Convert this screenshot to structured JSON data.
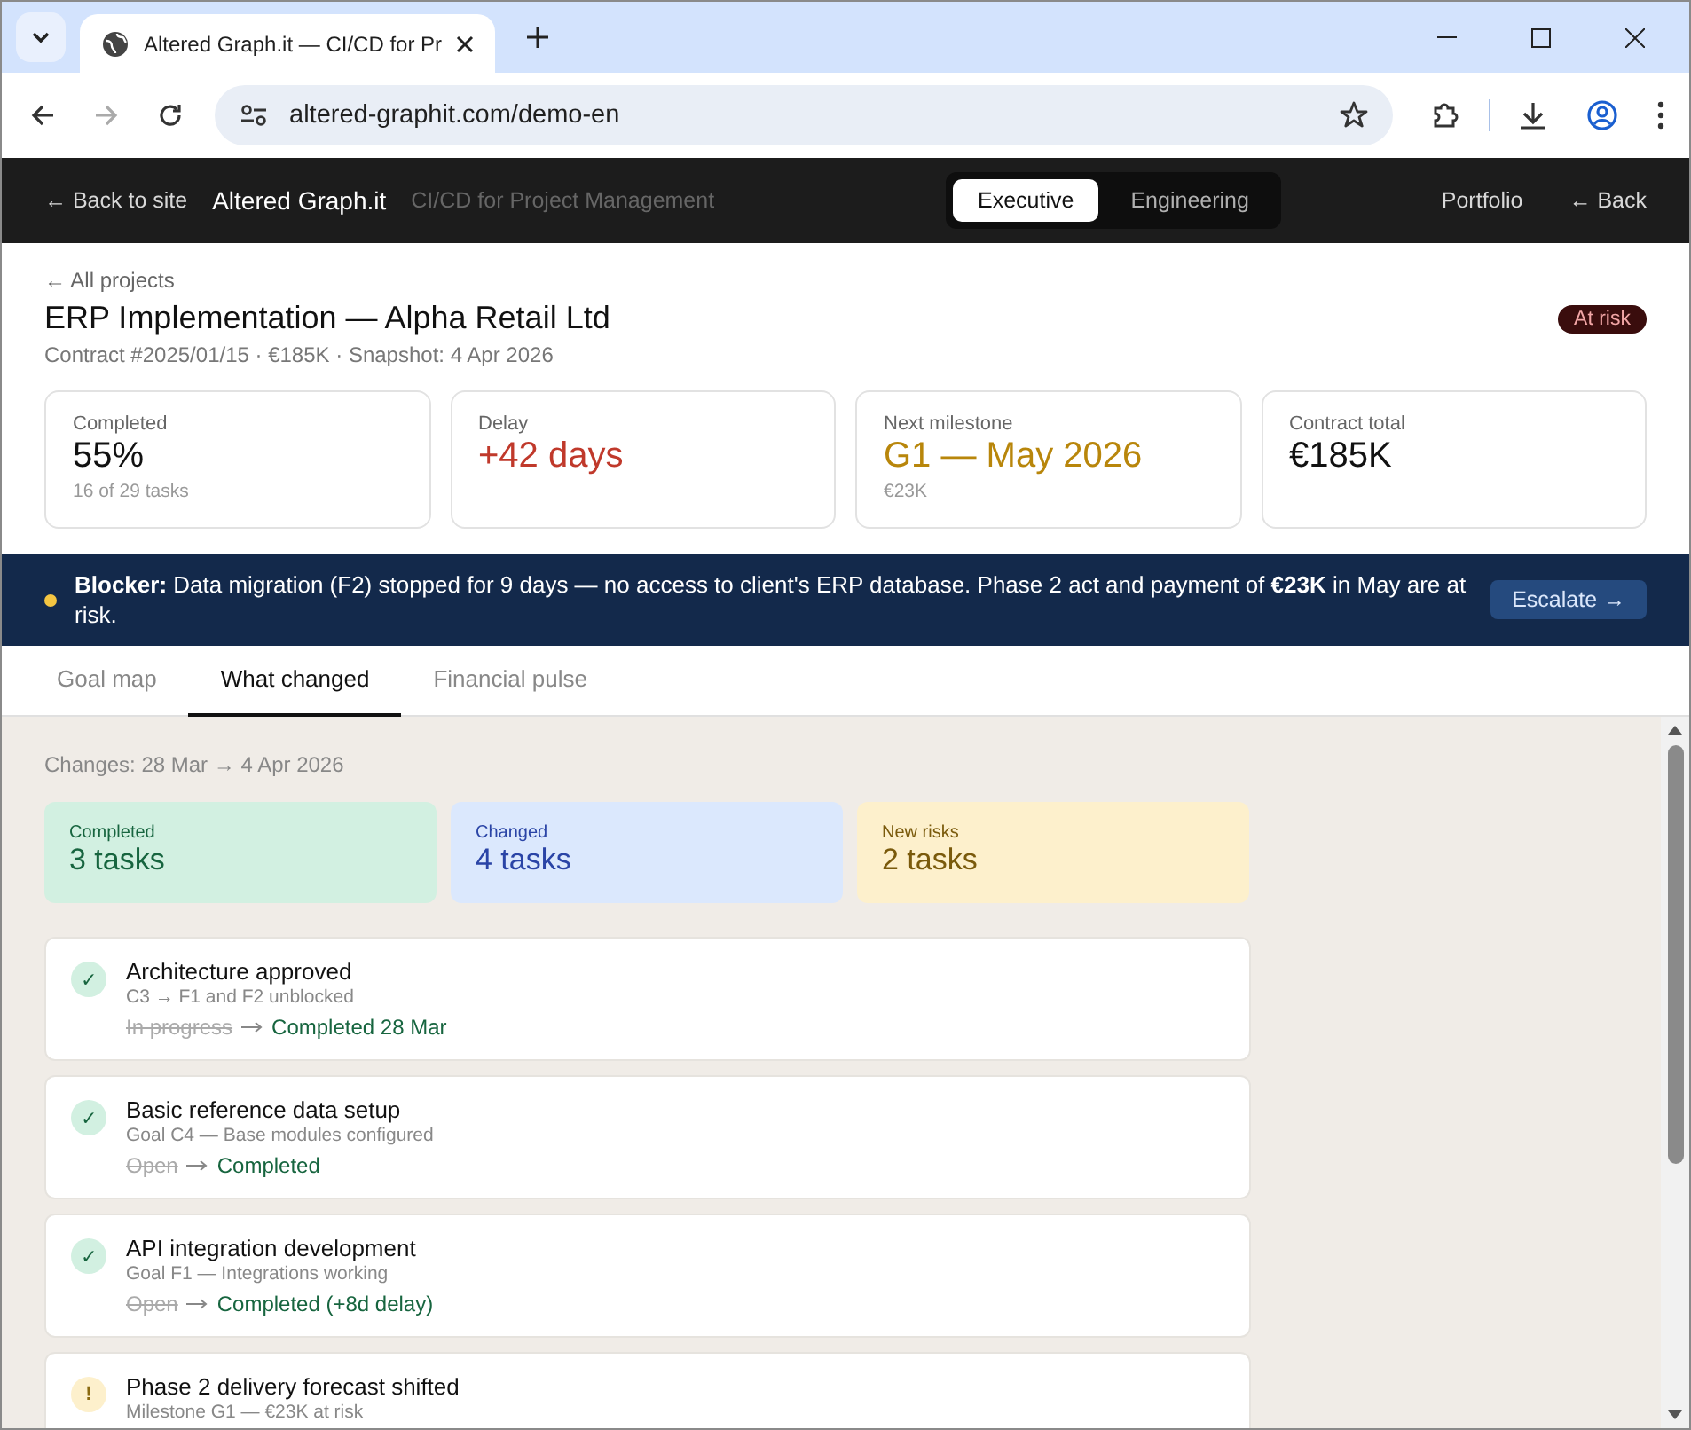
{
  "browser": {
    "tab_title": "Altered Graph.it — CI/CD for Pr",
    "url": "altered-graphit.com/demo-en"
  },
  "header": {
    "back_link": "← Back to site",
    "brand": "Altered Graph.it",
    "tagline": "CI/CD for Project Management",
    "views": [
      {
        "label": "Executive",
        "selected": true
      },
      {
        "label": "Engineering",
        "selected": false
      }
    ],
    "nav": [
      "Portfolio",
      "← Back"
    ]
  },
  "project": {
    "back_link": "← All projects",
    "title": "ERP Implementation — Alpha Retail Ltd",
    "meta": "Contract #2025/01/15 · €185K · Snapshot: 4 Apr 2026",
    "status": "At risk"
  },
  "kpis": [
    {
      "label": "Completed",
      "value": "55%",
      "note": "16 of 29 tasks"
    },
    {
      "label": "Delay",
      "value": "+42 days",
      "color": "#c0392b"
    },
    {
      "label": "Next milestone",
      "value": "G1 — May 2026",
      "note": "€23K",
      "color": "#b8860b"
    },
    {
      "label": "Contract total",
      "value": "€185K"
    }
  ],
  "blocker": {
    "text": "**Blocker:** Data migration (F2) stopped for 9 days — no access to client's ERP database. Phase 2 act and payment of **€23K** in May are at risk.",
    "action": "Escalate →"
  },
  "tabs": [
    {
      "label": "Goal map",
      "selected": false
    },
    {
      "label": "What changed",
      "selected": true
    },
    {
      "label": "Financial pulse",
      "selected": false
    }
  ],
  "changes": {
    "period": "Changes: 28 Mar → 4 Apr 2026",
    "summary": [
      {
        "label": "Completed",
        "value": "3 tasks",
        "color": "#d2f0e1"
      },
      {
        "label": "Changed",
        "value": "4 tasks",
        "color": "#dbe8fd"
      },
      {
        "label": "New risks",
        "value": "2 tasks",
        "color": "#fdf0cc"
      }
    ],
    "items": [
      {
        "kind": "done",
        "icon": "✓",
        "title": "Architecture approved",
        "subtitle": "C3 → F1 and F2 unblocked",
        "from": "In progress",
        "to": "Completed 28 Mar"
      },
      {
        "kind": "done",
        "icon": "✓",
        "title": "Basic reference data setup",
        "subtitle": "Goal C4 — Base modules configured",
        "from": "Open",
        "to": "Completed"
      },
      {
        "kind": "done",
        "icon": "✓",
        "title": "API integration development",
        "subtitle": "Goal F1 — Integrations working",
        "from": "Open",
        "to": "Completed (+8d delay)"
      },
      {
        "kind": "risk",
        "icon": "!",
        "title": "Phase 2 delivery forecast shifted",
        "subtitle": "Milestone G1 — €23K at risk"
      }
    ]
  }
}
